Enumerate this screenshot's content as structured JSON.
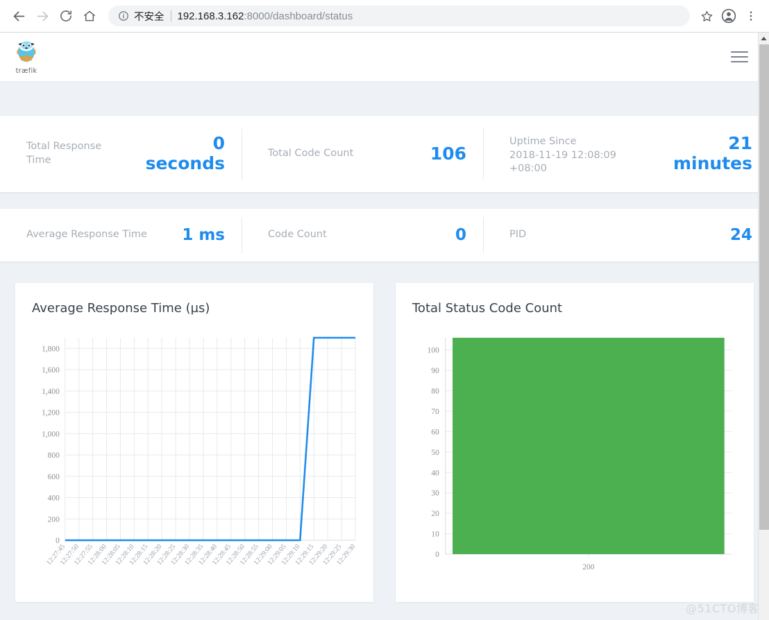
{
  "browser": {
    "back_icon": "arrow-left-icon",
    "forward_icon": "arrow-right-icon",
    "reload_icon": "reload-icon",
    "home_icon": "home-icon",
    "info_icon": "info-circle-icon",
    "security_label": "不安全",
    "url_host": "192.168.3.162",
    "url_path": ":8000/dashboard/status",
    "url_full": "192.168.3.162:8000/dashboard/status",
    "bookmark_icon": "star-icon",
    "profile_icon": "account-avatar-icon",
    "menu_icon": "three-dots-vertical-icon"
  },
  "header": {
    "brand_name": "træfik",
    "menu_icon": "hamburger-menu-icon"
  },
  "stats": {
    "row1": [
      {
        "label": "Total Response Time",
        "value": "0 seconds"
      },
      {
        "label": "Total Code Count",
        "value": "106"
      },
      {
        "label": "Uptime Since",
        "sub": "2018-11-19 12:08:09 +08:00",
        "value": "21 minutes"
      }
    ],
    "row2": [
      {
        "label": "Average Response Time",
        "value": "1 ms"
      },
      {
        "label": "Code Count",
        "value": "0"
      },
      {
        "label": "PID",
        "value": "24"
      }
    ]
  },
  "colors": {
    "accent_blue": "#1f8ced",
    "bar_green": "#4caf50",
    "line_blue": "#1f8ced",
    "page_bg": "#eef2f6",
    "label_gray": "#a7adb5"
  },
  "watermark": "@51CTO博客",
  "chart_data": [
    {
      "type": "line",
      "title": "Average Response Time (µs)",
      "xlabel": "",
      "ylabel": "",
      "ylim": [
        0,
        1900
      ],
      "yticks": [
        0,
        200,
        400,
        600,
        800,
        1000,
        1200,
        1400,
        1600,
        1800
      ],
      "ytick_labels": [
        "0",
        "200",
        "400",
        "600",
        "800",
        "1,000",
        "1,200",
        "1,400",
        "1,600",
        "1,800"
      ],
      "grid": true,
      "legend": "none",
      "x": [
        "12:27:45",
        "12:27:50",
        "12:27:55",
        "12:28:00",
        "12:28:05",
        "12:28:10",
        "12:28:15",
        "12:28:20",
        "12:28:25",
        "12:28:30",
        "12:28:35",
        "12:28:40",
        "12:28:45",
        "12:28:50",
        "12:28:55",
        "12:29:00",
        "12:29:05",
        "12:29:10",
        "12:29:15",
        "12:29:20",
        "12:29:25",
        "12:29:30"
      ],
      "series": [
        {
          "name": "Average Response Time",
          "color": "#1f8ced",
          "values": [
            0,
            0,
            0,
            0,
            0,
            0,
            0,
            0,
            0,
            0,
            0,
            0,
            0,
            0,
            0,
            0,
            0,
            0,
            1900,
            1900,
            1900,
            1900
          ]
        }
      ]
    },
    {
      "type": "bar",
      "title": "Total Status Code Count",
      "xlabel": "",
      "ylabel": "",
      "ylim": [
        0,
        106
      ],
      "yticks": [
        0,
        10,
        20,
        30,
        40,
        50,
        60,
        70,
        80,
        90,
        100
      ],
      "ytick_labels": [
        "0",
        "10",
        "20",
        "30",
        "40",
        "50",
        "60",
        "70",
        "80",
        "90",
        "100"
      ],
      "grid": true,
      "legend": "none",
      "categories": [
        "200"
      ],
      "values": [
        106
      ],
      "colors": [
        "#4caf50"
      ]
    }
  ]
}
